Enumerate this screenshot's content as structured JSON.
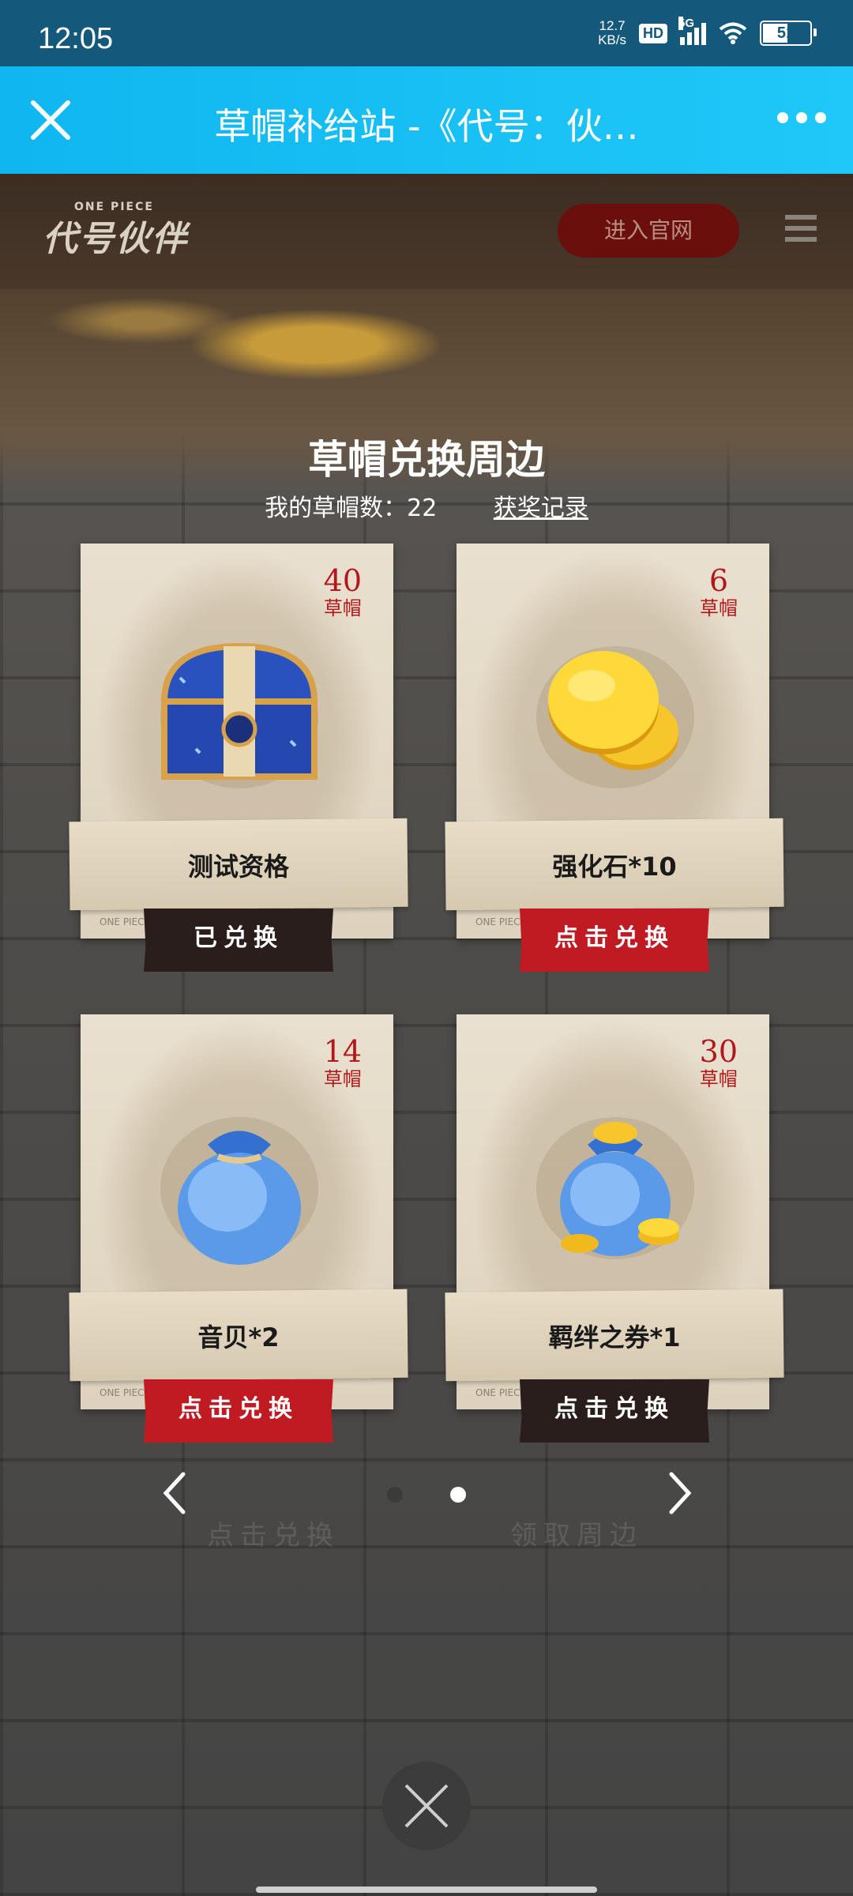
{
  "status_bar": {
    "time": "12:05",
    "net_speed": "12.7",
    "net_unit": "KB/s",
    "hd": "HD",
    "network": "5G",
    "battery": "51"
  },
  "nav": {
    "title": "草帽补给站 -《代号：伙…"
  },
  "header": {
    "logo_top": "ONE PIECE",
    "logo": "代号伙伴",
    "official_button": "进入官网"
  },
  "exchange": {
    "title": "草帽兑换周边",
    "count_label": "我的草帽数：22",
    "record_link": "获奖记录",
    "card_footer": "ONE PIECE",
    "cards": [
      {
        "price": "40",
        "unit": "草帽",
        "name": "测试资格",
        "action": "已兑换",
        "state": "done"
      },
      {
        "price": "6",
        "unit": "草帽",
        "name": "强化石*10",
        "action": "点击兑换",
        "state": "available"
      },
      {
        "price": "14",
        "unit": "草帽",
        "name": "音贝*2",
        "action": "点击兑换",
        "state": "available"
      },
      {
        "price": "30",
        "unit": "草帽",
        "name": "羁绊之券*1",
        "action": "点击兑换",
        "state": "available_dark"
      }
    ]
  },
  "pager": {
    "current_page": 2,
    "total_pages": 2,
    "bg_left": "点击兑换",
    "bg_right": "领取周边"
  },
  "colors": {
    "nav_bg": "#10b6f0",
    "status_bg": "#14597c",
    "price_red": "#b3161b",
    "action_red": "#c01b22",
    "action_dark": "#2a1e1c"
  }
}
